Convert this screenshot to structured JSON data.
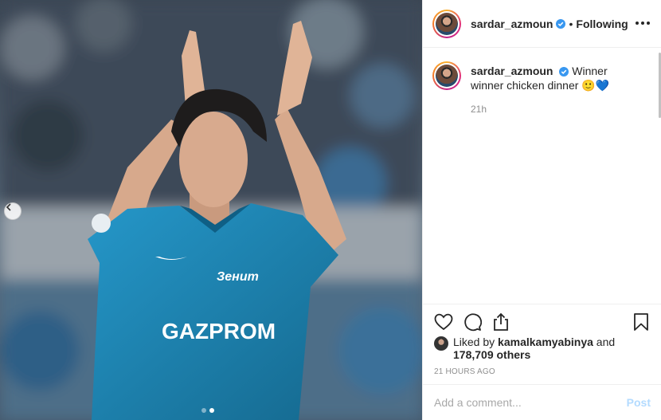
{
  "post": {
    "username": "sardar_azmoun",
    "follow_separator": "•",
    "follow_status": "Following",
    "caption_username": "sardar_azmoun",
    "caption_text": "Winner winner chicken dinner 🙂💙",
    "caption_time": "21h",
    "liked_by_prefix": "Liked by",
    "liked_by_user": "kamalkamyabinya",
    "liked_by_and": "and",
    "likes_count": "178,709 others",
    "posted_ago": "21 HOURS AGO"
  },
  "photo": {
    "jersey_brand": "GAZPROM",
    "jersey_club": "Зенит",
    "carousel_index": 1,
    "carousel_total": 2
  },
  "comment_form": {
    "placeholder": "Add a comment...",
    "post_label": "Post"
  },
  "colors": {
    "verified": "#3897f0",
    "jersey": "#1f87b8",
    "post_disabled": "#b3dbff"
  }
}
